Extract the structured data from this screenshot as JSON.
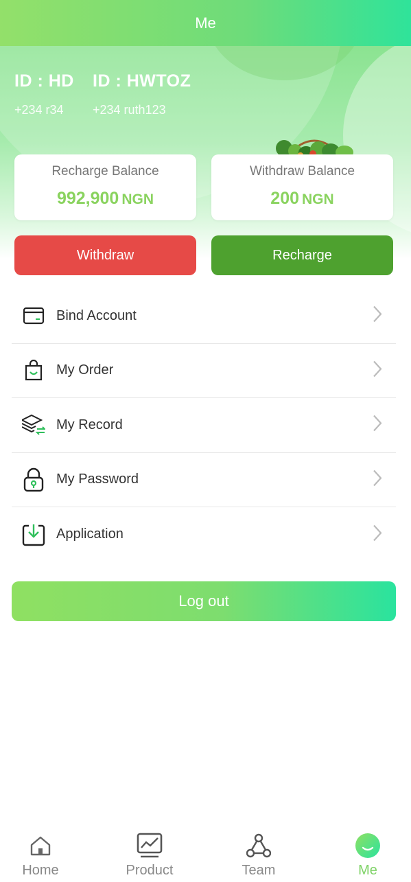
{
  "header": {
    "title": "Me"
  },
  "profile": {
    "accounts": [
      {
        "id": "ID : HD",
        "phone": "+234 r34"
      },
      {
        "id": "ID : HWTOZ",
        "phone": "+234 ruth123"
      }
    ]
  },
  "balances": {
    "recharge": {
      "label": "Recharge Balance",
      "amount": "992,900",
      "currency": "NGN"
    },
    "withdraw": {
      "label": "Withdraw Balance",
      "amount": "200",
      "currency": "NGN"
    }
  },
  "actions": {
    "withdraw_label": "Withdraw",
    "recharge_label": "Recharge"
  },
  "menu": {
    "items": [
      {
        "label": "Bind Account",
        "icon": "card-icon"
      },
      {
        "label": "My Order",
        "icon": "shopping-bag-icon"
      },
      {
        "label": "My Record",
        "icon": "layers-exchange-icon"
      },
      {
        "label": "My Password",
        "icon": "lock-icon"
      },
      {
        "label": "Application",
        "icon": "download-icon"
      }
    ]
  },
  "logout_label": "Log out",
  "tabbar": {
    "items": [
      {
        "label": "Home",
        "icon": "home-icon"
      },
      {
        "label": "Product",
        "icon": "chart-icon"
      },
      {
        "label": "Team",
        "icon": "team-icon"
      },
      {
        "label": "Me",
        "icon": "smile-icon",
        "active": true
      }
    ]
  },
  "colors": {
    "accent_green": "#8ad35f",
    "withdraw_red": "#e64a47",
    "recharge_green": "#4ea12f",
    "active_tab": "#7ed266"
  }
}
